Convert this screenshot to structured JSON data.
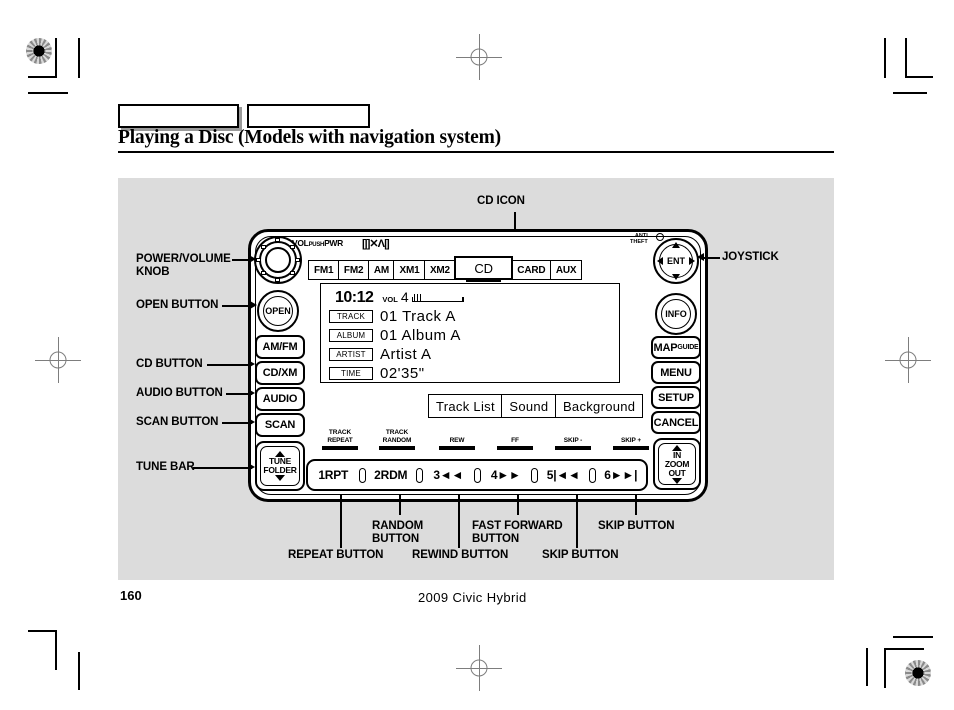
{
  "page": {
    "title": "Playing a Disc (Models with navigation system)",
    "number": "160",
    "footer_model": "2009  Civic  Hybrid"
  },
  "head_unit": {
    "faceplate": {
      "vol_label": "VOL",
      "push_label": "PUSH",
      "pwr_label": "PWR",
      "xm_logo": "[|]✕Λ|]",
      "anti_theft_line1": "ANTI",
      "anti_theft_line2": "THEFT"
    },
    "left_buttons": [
      {
        "name": "open",
        "label": "OPEN"
      },
      {
        "name": "am-fm",
        "label": "AM/FM"
      },
      {
        "name": "cd-xm",
        "label": "CD/XM"
      },
      {
        "name": "audio",
        "label": "AUDIO"
      },
      {
        "name": "scan",
        "label": "SCAN"
      }
    ],
    "tune_bar": {
      "line1": "TUNE",
      "line2": "FOLDER"
    },
    "right_buttons": [
      {
        "name": "enter",
        "label": "ENT"
      },
      {
        "name": "info",
        "label": "INFO"
      },
      {
        "name": "map-guide",
        "label": "MAP",
        "sub": "GUIDE"
      },
      {
        "name": "menu",
        "label": "MENU"
      },
      {
        "name": "setup",
        "label": "SETUP"
      },
      {
        "name": "cancel",
        "label": "CANCEL"
      }
    ],
    "zoom_rocker": {
      "line1": "IN",
      "line2": "ZOOM",
      "line3": "OUT"
    }
  },
  "screen": {
    "tabs": [
      {
        "label": "FM1",
        "selected": false
      },
      {
        "label": "FM2",
        "selected": false
      },
      {
        "label": "AM",
        "selected": false
      },
      {
        "label": "XM1",
        "selected": false
      },
      {
        "label": "XM2",
        "selected": false
      },
      {
        "label": "CD",
        "selected": true
      },
      {
        "label": "CARD",
        "selected": false
      },
      {
        "label": "AUX",
        "selected": false
      }
    ],
    "clock": "10:12",
    "volume": {
      "label": "VOL",
      "value": "4"
    },
    "rows": [
      {
        "tag": "TRACK",
        "value": "01  Track  A"
      },
      {
        "tag": "ALBUM",
        "value": "01  Album  A"
      },
      {
        "tag": "ARTIST",
        "value": "Artist  A"
      },
      {
        "tag": "TIME",
        "value": "02'35\""
      }
    ],
    "softkeys": [
      {
        "label": "Track  List"
      },
      {
        "label": "Sound"
      },
      {
        "label": "Background"
      }
    ]
  },
  "preset_strip": {
    "legends": [
      {
        "line1": "TRACK",
        "line2": "REPEAT"
      },
      {
        "line1": "TRACK",
        "line2": "RANDOM"
      },
      {
        "line1": "REW",
        "line2": ""
      },
      {
        "line1": "FF",
        "line2": ""
      },
      {
        "line1": "SKIP -",
        "line2": ""
      },
      {
        "line1": "SKIP +",
        "line2": ""
      }
    ],
    "buttons": [
      {
        "label": "1RPT"
      },
      {
        "label": "2RDM"
      },
      {
        "label": "3◄◄"
      },
      {
        "label": "4►►"
      },
      {
        "label": "5|◄◄"
      },
      {
        "label": "6►►|"
      }
    ]
  },
  "callouts": {
    "top": {
      "label": "CD ICON"
    },
    "left": [
      {
        "line1": "POWER/VOLUME",
        "line2": "KNOB"
      },
      {
        "line1": "OPEN BUTTON",
        "line2": ""
      },
      {
        "line1": "CD BUTTON",
        "line2": ""
      },
      {
        "line1": "AUDIO BUTTON",
        "line2": ""
      },
      {
        "line1": "SCAN BUTTON",
        "line2": ""
      },
      {
        "line1": "TUNE BAR",
        "line2": ""
      }
    ],
    "right": [
      {
        "line1": "JOYSTICK",
        "line2": ""
      }
    ],
    "bottom": [
      {
        "line1": "REPEAT BUTTON",
        "line2": ""
      },
      {
        "line1": "RANDOM",
        "line2": "BUTTON"
      },
      {
        "line1": "REWIND BUTTON",
        "line2": ""
      },
      {
        "line1": "FAST FORWARD",
        "line2": "BUTTON"
      },
      {
        "line1": "SKIP    BUTTON",
        "line2": ""
      },
      {
        "line1": "SKIP   BUTTON",
        "line2": ""
      }
    ]
  }
}
